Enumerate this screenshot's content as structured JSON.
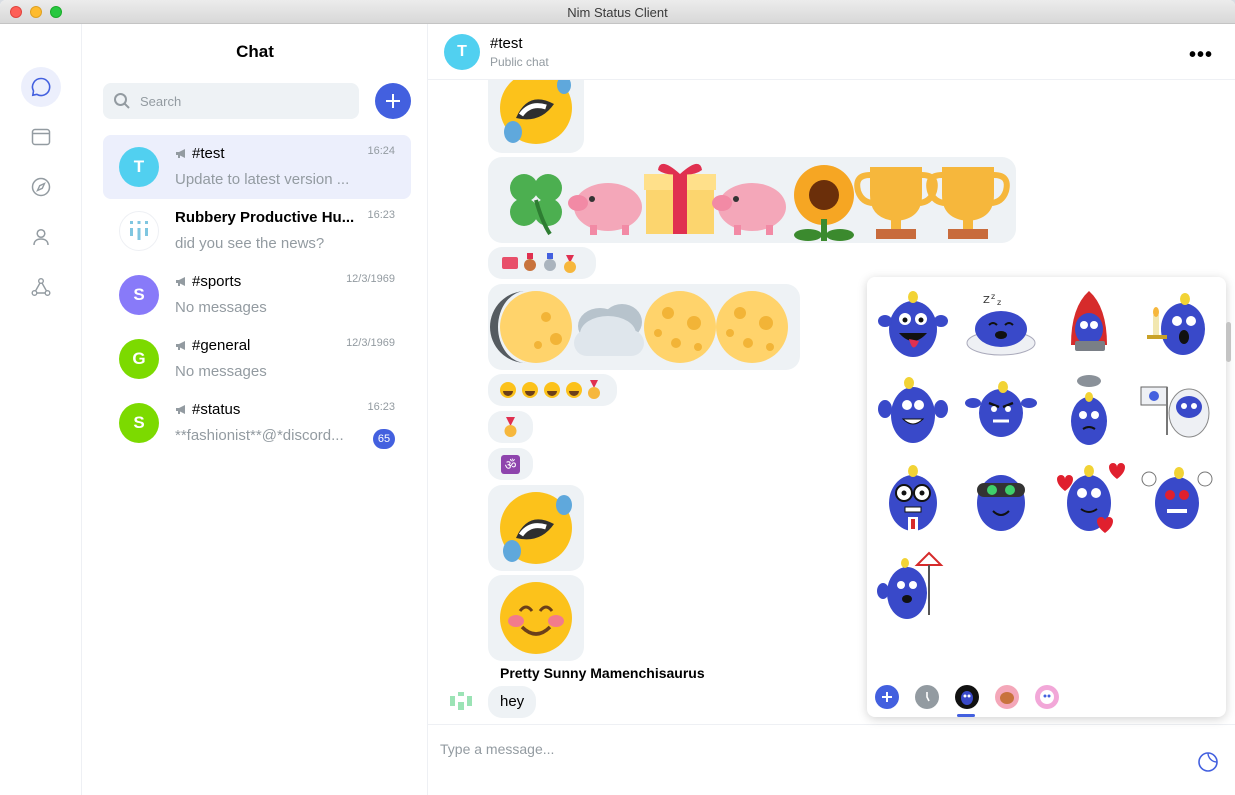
{
  "window": {
    "title": "Nim Status Client"
  },
  "sidebar": {
    "title": "Chat",
    "search_placeholder": "Search"
  },
  "colors": {
    "accent": "#4360df",
    "bubble": "#eef2f5",
    "muted": "#939ba1"
  },
  "chats": [
    {
      "initial": "T",
      "name": "#test",
      "time": "16:24",
      "preview": "Update to latest version ...",
      "color": "#51d0f0",
      "channel": true,
      "active": true,
      "unread": ""
    },
    {
      "initial": "",
      "name": "Rubbery Productive Hu...",
      "time": "16:23",
      "preview": "did you see the news?",
      "color": "#ffffff",
      "channel": false,
      "active": false,
      "unread": ""
    },
    {
      "initial": "S",
      "name": "#sports",
      "time": "12/3/1969",
      "preview": "No messages",
      "color": "#887af9",
      "channel": true,
      "active": false,
      "unread": ""
    },
    {
      "initial": "G",
      "name": "#general",
      "time": "12/3/1969",
      "preview": "No messages",
      "color": "#7cda00",
      "channel": true,
      "active": false,
      "unread": ""
    },
    {
      "initial": "S",
      "name": "#status",
      "time": "16:23",
      "preview": "**fashionist**@*discord...",
      "color": "#7cda00",
      "channel": true,
      "active": false,
      "unread": "65"
    }
  ],
  "header": {
    "initial": "T",
    "name": "#test",
    "subtitle": "Public chat",
    "more": "•••"
  },
  "messages": {
    "sender": "Pretty Sunny Mamenchisaurus",
    "last_text": "hey"
  },
  "composer": {
    "placeholder": "Type a message..."
  },
  "sticker_packs": [
    "add-pack",
    "recent",
    "pack-1",
    "pack-2",
    "pack-3"
  ]
}
